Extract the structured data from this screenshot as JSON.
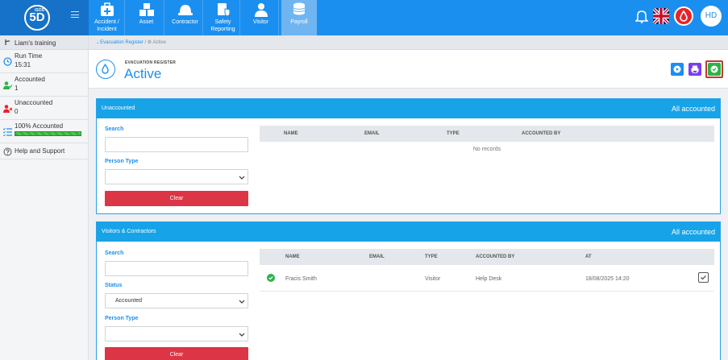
{
  "app": {
    "logo_text": "5D",
    "logo_sub": "iSOS"
  },
  "nav": {
    "tabs": [
      {
        "label_line1": "Accident /",
        "label_line2": "Incident",
        "icon": "first-aid-icon"
      },
      {
        "label_line1": "Asset",
        "label_line2": "",
        "icon": "boxes-icon"
      },
      {
        "label_line1": "Contractor",
        "label_line2": "",
        "icon": "hardhat-icon"
      },
      {
        "label_line1": "Safety",
        "label_line2": "Reporting",
        "icon": "clipboard-shield-icon"
      },
      {
        "label_line1": "Visitor",
        "label_line2": "",
        "icon": "person-icon"
      },
      {
        "label_line1": "Payroll",
        "label_line2": "",
        "icon": "coins-icon"
      }
    ],
    "avatar_initials": "HD"
  },
  "sidebar": {
    "header": "Liam's training",
    "run_time_label": "Run Time",
    "run_time_value": "15:31",
    "accounted_label": "Accounted",
    "accounted_value": "1",
    "unaccounted_label": "Unaccounted",
    "unaccounted_value": "0",
    "percent_label": "100% Accounted",
    "percent_value": 100,
    "help_label": "Help and Support"
  },
  "breadcrumb": {
    "root": "Evacuation Register",
    "separator": "/",
    "current": "Active"
  },
  "header": {
    "small_title": "EVACUATION REGISTER",
    "title": "Active"
  },
  "unaccounted_panel": {
    "title": "Unaccounted",
    "status": "All accounted",
    "search_label": "Search",
    "person_type_label": "Person Type",
    "person_type_value": "",
    "clear_label": "Clear",
    "columns": [
      "NAME",
      "EMAIL",
      "TYPE",
      "ACCOUNTED BY"
    ],
    "empty_text": "No records"
  },
  "visitors_panel": {
    "title": "Visitors & Contractors",
    "status": "All accounted",
    "search_label": "Search",
    "status_label": "Status",
    "status_value": "Accounted",
    "person_type_label": "Person Type",
    "person_type_value": "",
    "clear_label": "Clear",
    "columns": [
      "NAME",
      "EMAIL",
      "TYPE",
      "ACCOUNTED BY",
      "AT"
    ],
    "rows": [
      {
        "name": "Fracis Smith",
        "email": "",
        "type": "Visitor",
        "accounted_by": "Help Desk",
        "at": "18/08/2025 14:20"
      }
    ]
  },
  "colors": {
    "primary": "#1b8ff0",
    "panel_header": "#17a3e8",
    "danger": "#dc3545",
    "success": "#2bb34a",
    "purple": "#7d3cf0"
  }
}
